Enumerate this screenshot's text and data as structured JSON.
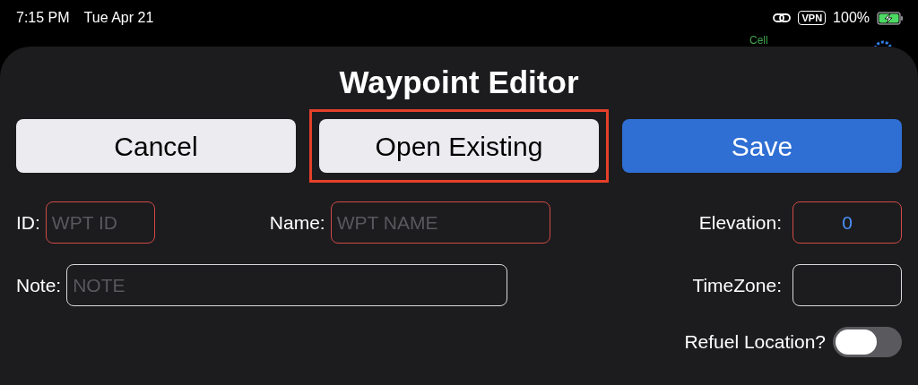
{
  "status_bar": {
    "time": "7:15 PM",
    "date": "Tue Apr 21",
    "vpn": "VPN",
    "battery_percent": "100%",
    "charging": true
  },
  "background": {
    "cell_label": "Cell"
  },
  "sheet": {
    "title": "Waypoint Editor",
    "buttons": [
      {
        "label": "Cancel",
        "kind": "plain",
        "highlighted": false
      },
      {
        "label": "Open Existing",
        "kind": "plain",
        "highlighted": true
      },
      {
        "label": "Save",
        "kind": "primary",
        "highlighted": false
      }
    ],
    "fields": [
      {
        "label": "ID:",
        "placeholder": "WPT ID",
        "invalid": true
      },
      {
        "label": "Name:",
        "placeholder": "WPT NAME",
        "invalid": true
      },
      {
        "label": "Elevation:",
        "value": "0",
        "invalid": true
      },
      {
        "label": "Note:",
        "placeholder": "NOTE",
        "invalid": false
      },
      {
        "label": "TimeZone:",
        "invalid": false
      }
    ],
    "refuel": {
      "label": "Refuel Location?",
      "on": false
    }
  }
}
